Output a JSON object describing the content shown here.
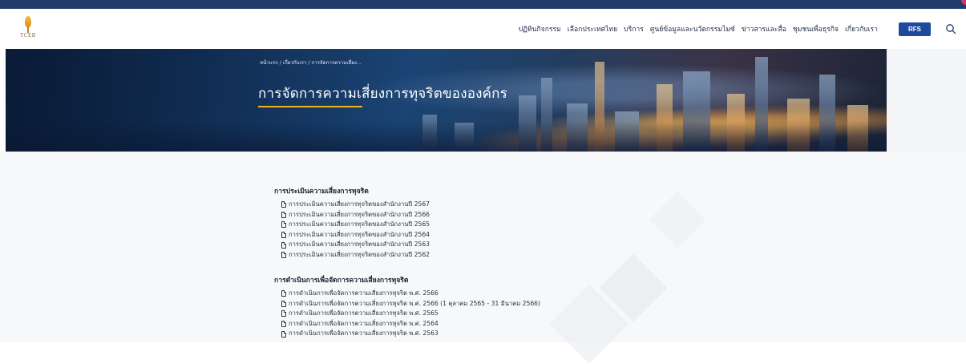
{
  "header": {
    "logo_text": "TCEB",
    "nav": [
      "ปฏิทินกิจกรรม",
      "เลือกประเทศไทย",
      "บริการ",
      "ศูนย์ข้อมูลและนวัตกรรมไมซ์",
      "ข่าวสารและสื่อ",
      "ชุมชนเพื่อธุรกิจ",
      "เกี่ยวกับเรา"
    ],
    "rfs_label": "RFS",
    "search_icon": "search-icon"
  },
  "banner": {
    "breadcrumb": "หน้าแรก / เกี่ยวกับเรา / การจัดการความเสี่ยง...",
    "title": "การจัดการความเสี่ยงการทุจริตขององค์กร"
  },
  "sections": [
    {
      "heading": "การประเมินความเสี่ยงการทุจริต",
      "items": [
        "การประเมินความเสี่ยงการทุจริตของสำนักงานปี 2567",
        "การประเมินความเสี่ยงการทุจริตของสำนักงานปี 2566",
        "การประเมินความเสี่ยงการทุจริตของสำนักงานปี 2565",
        "การประเมินความเสี่ยงการทุจริตของสำนักงานปี 2564",
        "การประเมินความเสี่ยงการทุจริตของสำนักงานปี 2563",
        "การประเมินความเสี่ยงการทุจริตของสำนักงานปี 2562"
      ]
    },
    {
      "heading": "การดำเนินการเพื่อจัดการความเสี่ยงการทุจริต",
      "items": [
        "การดำเนินการเพื่อจัดการความเสี่ยงการทุจริต พ.ศ. 2566",
        "การดำเนินการเพื่อจัดการความเสี่ยงการทุจริต พ.ศ. 2566 (1 ตุลาคม 2565 - 31 มีนาคม 2566)",
        "การดำเนินการเพื่อจัดการความเสี่ยงการทุจริต พ.ศ. 2565",
        "การดำเนินการเพื่อจัดการความเสี่ยงการทุจริต พ.ศ. 2564",
        "การดำเนินการเพื่อจัดการความเสี่ยงการทุจริต พ.ศ. 2563"
      ]
    }
  ],
  "colors": {
    "top_strip": "#1f3a6b",
    "rfs_button": "#1e4a9b",
    "title_underline": "#f0b41c"
  }
}
